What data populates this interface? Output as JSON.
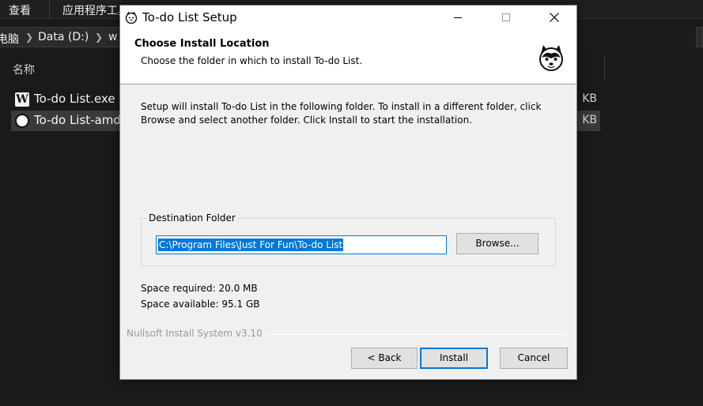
{
  "explorer": {
    "menu": [
      "查看",
      "应用程序工具"
    ],
    "address": [
      "电脑",
      "Data (D:)",
      "w"
    ],
    "column_name": "名称",
    "files": [
      {
        "name": "To-do List.exe",
        "size": "KB",
        "icon": "w-app-icon"
      },
      {
        "name": "To-do List-amd",
        "size": "KB",
        "icon": "husky-icon"
      }
    ]
  },
  "window": {
    "title": "To-do List Setup",
    "header_title": "Choose Install Location",
    "header_subtitle": "Choose the folder in which to install To-do List.",
    "body_text": "Setup will install To-do List in the following folder. To install in a different folder, click Browse and select another folder. Click Install to start the installation.",
    "destination_label": "Destination Folder",
    "destination_path": "C:\\Program Files\\Just For Fun\\To-do List",
    "browse_label": "Browse...",
    "space_required": "Space required: 20.0 MB",
    "space_available": "Space available: 95.1 GB",
    "branding": "Nullsoft Install System v3.10",
    "back_label": "< Back",
    "install_label": "Install",
    "cancel_label": "Cancel"
  },
  "colors": {
    "accent": "#0078d7",
    "dark_bg": "#1a1a1a",
    "dialog_bg": "#f0f0f0"
  }
}
